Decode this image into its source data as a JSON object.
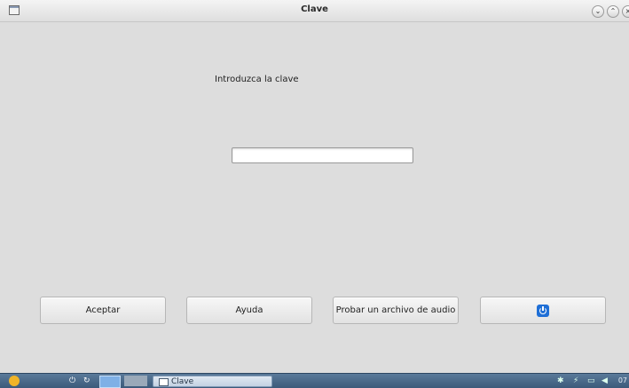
{
  "window": {
    "title": "Clave"
  },
  "dialog": {
    "prompt": "Introduzca la clave",
    "password_value": "",
    "buttons": {
      "accept": "Aceptar",
      "help": "Ayuda",
      "test_audio": "Probar un archivo de audio"
    }
  },
  "taskbar": {
    "task_label": "Clave",
    "clock": "07"
  },
  "icons": {
    "power": "power-icon",
    "window_menu": "window-menu-icon",
    "minimize": "chevron-down-icon",
    "maximize": "chevron-up-icon",
    "close": "close-icon"
  }
}
